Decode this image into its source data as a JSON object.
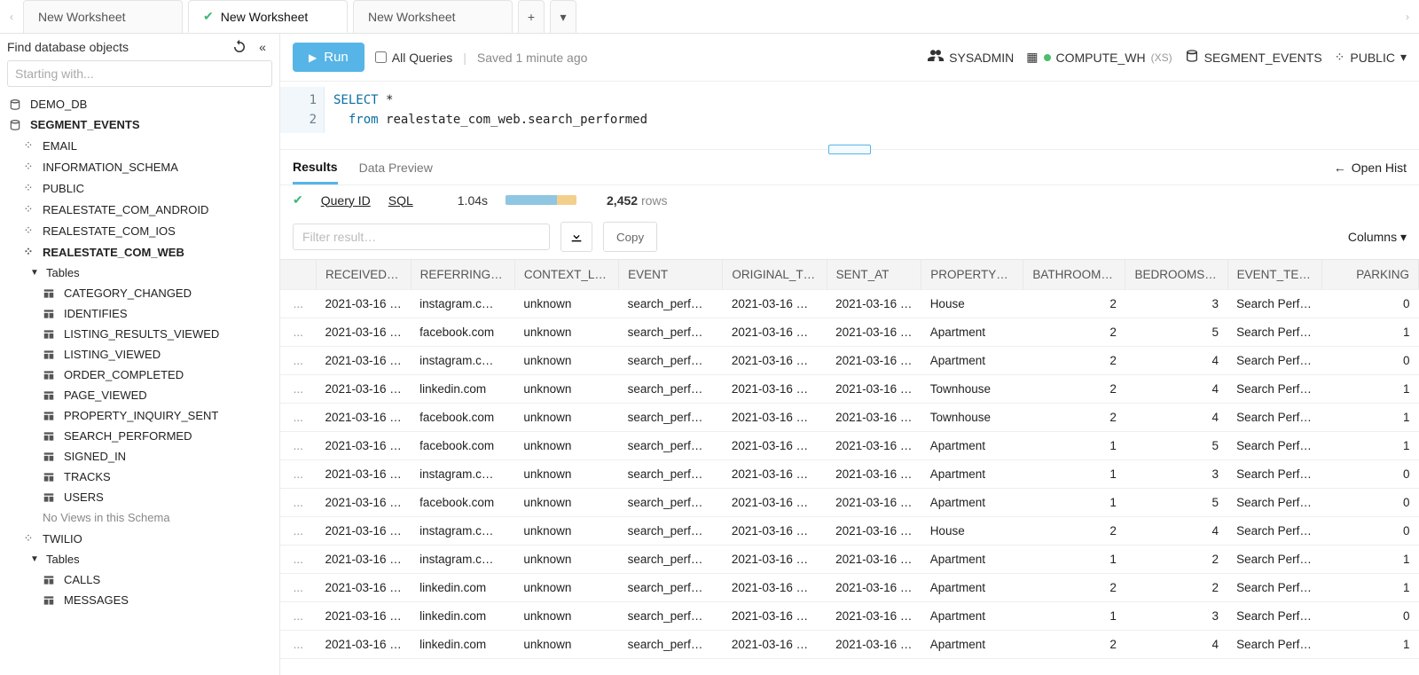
{
  "tabs": [
    {
      "label": "New Worksheet",
      "active": false
    },
    {
      "label": "New Worksheet",
      "active": true,
      "check": true
    },
    {
      "label": "New Worksheet",
      "active": false
    }
  ],
  "tabadd": "+",
  "tabmore": "▾",
  "sidebar": {
    "find_label": "Find database objects",
    "find_placeholder": "Starting with...",
    "databases": [
      {
        "name": "DEMO_DB",
        "expanded": false
      },
      {
        "name": "SEGMENT_EVENTS",
        "expanded": true,
        "schemas": [
          {
            "name": "EMAIL"
          },
          {
            "name": "INFORMATION_SCHEMA"
          },
          {
            "name": "PUBLIC"
          },
          {
            "name": "REALESTATE_COM_ANDROID"
          },
          {
            "name": "REALESTATE_COM_IOS"
          },
          {
            "name": "REALESTATE_COM_WEB",
            "expanded": true,
            "bold": true,
            "tables_label": "Tables",
            "tables": [
              "CATEGORY_CHANGED",
              "IDENTIFIES",
              "LISTING_RESULTS_VIEWED",
              "LISTING_VIEWED",
              "ORDER_COMPLETED",
              "PAGE_VIEWED",
              "PROPERTY_INQUIRY_SENT",
              "SEARCH_PERFORMED",
              "SIGNED_IN",
              "TRACKS",
              "USERS"
            ],
            "no_views": "No Views in this Schema"
          },
          {
            "name": "TWILIO",
            "expanded": true,
            "tables_label": "Tables",
            "tables": [
              "CALLS",
              "MESSAGES"
            ]
          }
        ]
      }
    ]
  },
  "toolbar": {
    "run": "Run",
    "all_queries": "All Queries",
    "saved": "Saved 1 minute ago",
    "role": "SYSADMIN",
    "warehouse": "COMPUTE_WH",
    "warehouse_size": "(XS)",
    "database": "SEGMENT_EVENTS",
    "schema": "PUBLIC"
  },
  "editor": {
    "lines": [
      "1",
      "2"
    ],
    "l1_kw": "SELECT",
    "l1_rest": "*",
    "l2_kw": "from",
    "l2_rest": "realestate_com_web.search_performed"
  },
  "result_tabs": {
    "results": "Results",
    "preview": "Data Preview",
    "open_hist": "Open Hist"
  },
  "qmeta": {
    "query_id": "Query ID",
    "sql": "SQL",
    "time": "1.04s",
    "count": "2,452",
    "rows": "rows"
  },
  "filter": {
    "placeholder": "Filter result…",
    "copy": "Copy",
    "columns": "Columns ▾"
  },
  "grid": {
    "columns": [
      "",
      "RECEIVED_AT",
      "REFERRING_DOMAIN",
      "CONTEXT_LIBRARY",
      "EVENT",
      "ORIGINAL_TIMESTAMP",
      "SENT_AT",
      "PROPERTY_TYPE",
      "BATHROOMS_MIN",
      "BEDROOMS_MAX",
      "EVENT_TEXT",
      "PARKING"
    ],
    "rows": [
      [
        "...",
        "2021-03-16 …",
        "instagram.c…",
        "unknown",
        "search_perf…",
        "2021-03-16 …",
        "2021-03-16 …",
        "House",
        "2",
        "3",
        "Search Perf…",
        "0"
      ],
      [
        "...",
        "2021-03-16 …",
        "facebook.com",
        "unknown",
        "search_perf…",
        "2021-03-16 …",
        "2021-03-16 …",
        "Apartment",
        "2",
        "5",
        "Search Perf…",
        "1"
      ],
      [
        "...",
        "2021-03-16 …",
        "instagram.c…",
        "unknown",
        "search_perf…",
        "2021-03-16 …",
        "2021-03-16 …",
        "Apartment",
        "2",
        "4",
        "Search Perf…",
        "0"
      ],
      [
        "...",
        "2021-03-16 …",
        "linkedin.com",
        "unknown",
        "search_perf…",
        "2021-03-16 …",
        "2021-03-16 …",
        "Townhouse",
        "2",
        "4",
        "Search Perf…",
        "1"
      ],
      [
        "...",
        "2021-03-16 …",
        "facebook.com",
        "unknown",
        "search_perf…",
        "2021-03-16 …",
        "2021-03-16 …",
        "Townhouse",
        "2",
        "4",
        "Search Perf…",
        "1"
      ],
      [
        "...",
        "2021-03-16 …",
        "facebook.com",
        "unknown",
        "search_perf…",
        "2021-03-16 …",
        "2021-03-16 …",
        "Apartment",
        "1",
        "5",
        "Search Perf…",
        "1"
      ],
      [
        "...",
        "2021-03-16 …",
        "instagram.c…",
        "unknown",
        "search_perf…",
        "2021-03-16 …",
        "2021-03-16 …",
        "Apartment",
        "1",
        "3",
        "Search Perf…",
        "0"
      ],
      [
        "...",
        "2021-03-16 …",
        "facebook.com",
        "unknown",
        "search_perf…",
        "2021-03-16 …",
        "2021-03-16 …",
        "Apartment",
        "1",
        "5",
        "Search Perf…",
        "0"
      ],
      [
        "...",
        "2021-03-16 …",
        "instagram.c…",
        "unknown",
        "search_perf…",
        "2021-03-16 …",
        "2021-03-16 …",
        "House",
        "2",
        "4",
        "Search Perf…",
        "0"
      ],
      [
        "...",
        "2021-03-16 …",
        "instagram.c…",
        "unknown",
        "search_perf…",
        "2021-03-16 …",
        "2021-03-16 …",
        "Apartment",
        "1",
        "2",
        "Search Perf…",
        "1"
      ],
      [
        "...",
        "2021-03-16 …",
        "linkedin.com",
        "unknown",
        "search_perf…",
        "2021-03-16 …",
        "2021-03-16 …",
        "Apartment",
        "2",
        "2",
        "Search Perf…",
        "1"
      ],
      [
        "...",
        "2021-03-16 …",
        "linkedin.com",
        "unknown",
        "search_perf…",
        "2021-03-16 …",
        "2021-03-16 …",
        "Apartment",
        "1",
        "3",
        "Search Perf…",
        "0"
      ],
      [
        "...",
        "2021-03-16 …",
        "linkedin.com",
        "unknown",
        "search_perf…",
        "2021-03-16 …",
        "2021-03-16 …",
        "Apartment",
        "2",
        "4",
        "Search Perf…",
        "1"
      ]
    ]
  }
}
